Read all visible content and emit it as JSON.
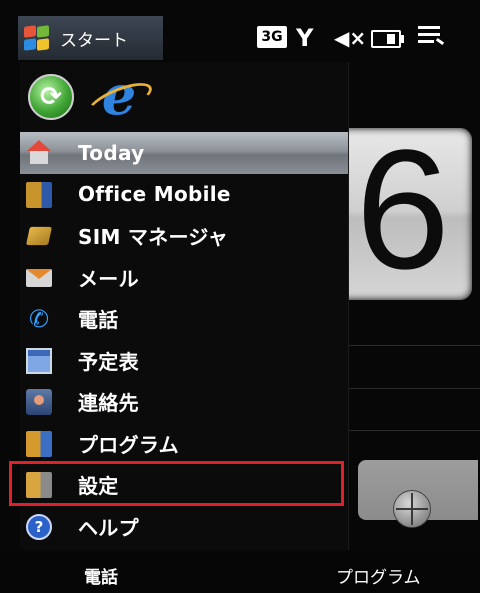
{
  "status_bar": {
    "start_label": "スタート",
    "network_label": "3G",
    "icons": [
      "windows-logo-icon",
      "network-3g-icon",
      "signal-icon",
      "volume-muted-icon",
      "battery-icon",
      "menu-icon"
    ]
  },
  "background": {
    "clock_digit": "6"
  },
  "pinned": [
    {
      "name": "sync-icon"
    },
    {
      "name": "internet-explorer-icon",
      "glyph": "e"
    }
  ],
  "menu": {
    "items": [
      {
        "label": "Today",
        "icon": "home-icon",
        "selected": true
      },
      {
        "label": "Office Mobile",
        "icon": "office-icon"
      },
      {
        "label": "SIM マネージャ",
        "icon": "sim-card-icon"
      },
      {
        "label": "メール",
        "icon": "mail-icon"
      },
      {
        "label": "電話",
        "icon": "phone-icon"
      },
      {
        "label": "予定表",
        "icon": "calendar-icon"
      },
      {
        "label": "連絡先",
        "icon": "contacts-icon"
      },
      {
        "label": "プログラム",
        "icon": "programs-folder-icon"
      },
      {
        "label": "設定",
        "icon": "settings-folder-icon",
        "highlighted": true
      },
      {
        "label": "ヘルプ",
        "icon": "help-icon",
        "glyph": "?"
      }
    ]
  },
  "softkeys": {
    "left": "電話",
    "right": "プログラム"
  },
  "colors": {
    "highlight_box": "#e0202a",
    "selected_item": "#8d9299",
    "menu_background": "#0b0b0b"
  }
}
